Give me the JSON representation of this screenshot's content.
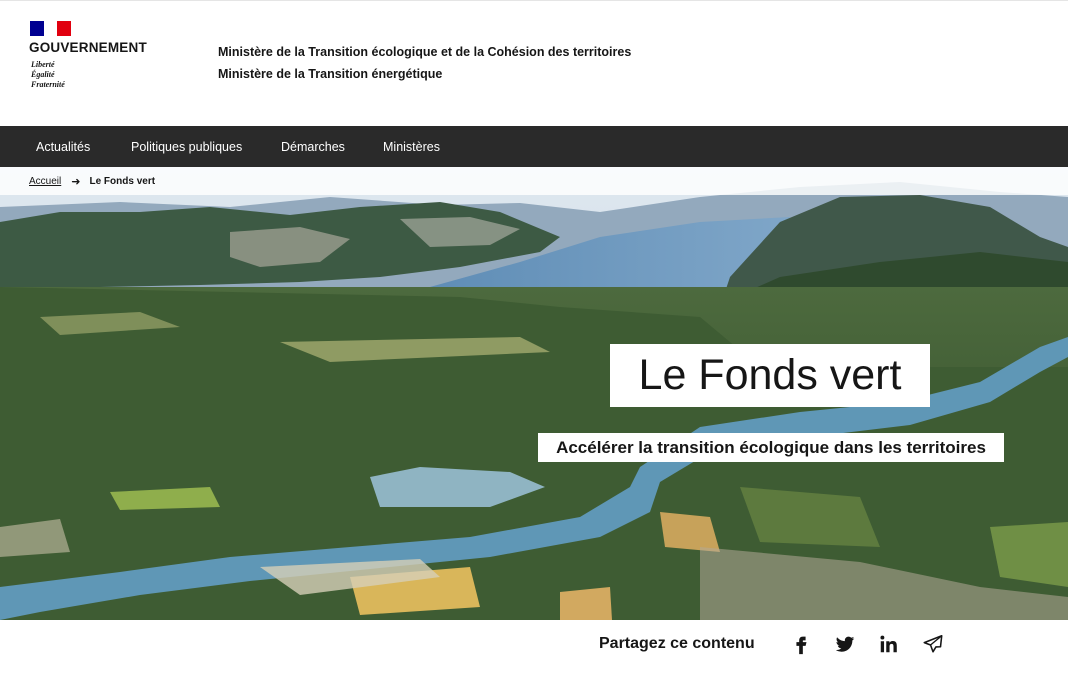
{
  "header": {
    "gov_name": "GOUVERNEMENT",
    "motto": [
      "Liberté",
      "Égalité",
      "Fraternité"
    ],
    "ministries": [
      "Ministère de la Transition écologique et de la Cohésion des territoires",
      "Ministère de la Transition énergétique"
    ],
    "flag_colors": [
      "#000091",
      "#ffffff",
      "#e1000f"
    ]
  },
  "nav": {
    "items": [
      "Actualités",
      "Politiques publiques",
      "Démarches",
      "Ministères"
    ],
    "background": "#2a2a2a"
  },
  "breadcrumb": {
    "home": "Accueil",
    "current": "Le Fonds vert"
  },
  "hero": {
    "title": "Le Fonds vert",
    "subtitle": "Accélérer la transition écologique dans les territoires",
    "image": "aerial-landscape-lake-river-mountains"
  },
  "share": {
    "label": "Partagez ce contenu",
    "icons": [
      "facebook-icon",
      "twitter-icon",
      "linkedin-icon",
      "send-mail-icon"
    ]
  }
}
